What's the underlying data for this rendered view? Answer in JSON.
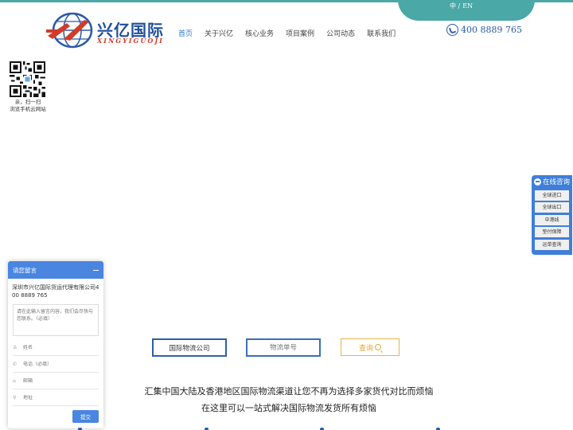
{
  "header": {
    "lang": {
      "zh": "中 /",
      "en": "EN"
    },
    "logo": {
      "cn": "兴亿国际",
      "en": "XINGYIGUOJI"
    },
    "nav": [
      {
        "label": "首页",
        "active": true
      },
      {
        "label": "关于兴亿",
        "active": false
      },
      {
        "label": "核心业务",
        "active": false
      },
      {
        "label": "项目案例",
        "active": false
      },
      {
        "label": "公司动态",
        "active": false
      },
      {
        "label": "联系我们",
        "active": false
      }
    ],
    "phone": "400 8889 765"
  },
  "qr": {
    "line1": "亲，扫一扫",
    "line2": "浏览手机云网站"
  },
  "side_panel": {
    "title": "在线咨询",
    "items": [
      "全球进口",
      "全球出口",
      "中港线",
      "垫付保障",
      "运单查询"
    ]
  },
  "message_box": {
    "title": "请您留言",
    "company": "深圳市兴亿国际货运代理有限公司400 8889 765",
    "textarea_placeholder": "请在此输入留言内容，我们会尽快与您联系。（必填）",
    "fields": [
      {
        "icon": "user-icon",
        "glyph": "♙",
        "placeholder": "姓名"
      },
      {
        "icon": "phone-icon",
        "glyph": "✆",
        "placeholder": "电话（必填）"
      },
      {
        "icon": "home-icon",
        "glyph": "⌂",
        "placeholder": "邮箱"
      },
      {
        "icon": "location-icon",
        "glyph": "⚲",
        "placeholder": "地址"
      }
    ],
    "submit": "提交"
  },
  "search": {
    "country_select": "国际物流公司",
    "tracking_placeholder": "物流单号",
    "query_button": "查询"
  },
  "slogan": {
    "line1": "汇集中国大陆及香港地区国际物流渠道让您不再为选择多家货代对比而烦恼",
    "line2": "在这里可以一站式解决国际物流发货所有烦恼"
  },
  "colors": {
    "accent": "#4aa8a6",
    "brand_blue": "#2b5aa8",
    "panel_blue": "#3f7fd9",
    "query_gold": "#e5b64e"
  }
}
